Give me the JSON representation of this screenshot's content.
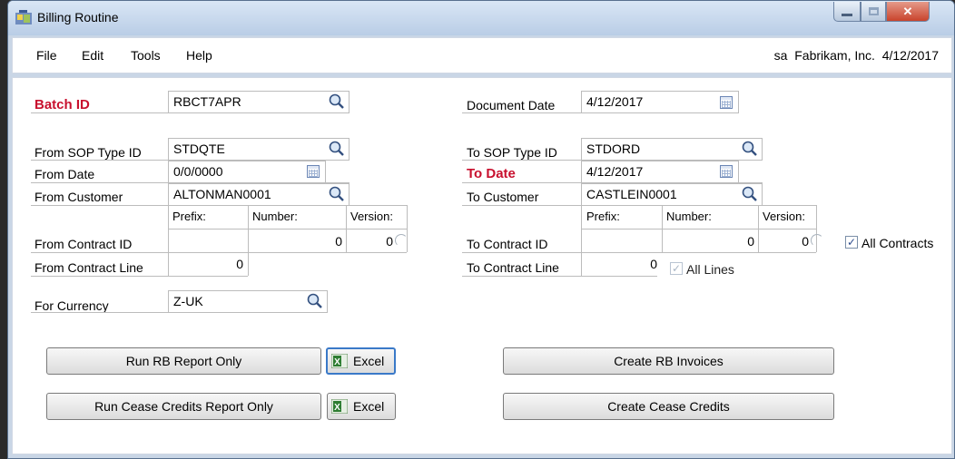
{
  "window": {
    "title": "Billing Routine"
  },
  "menu": {
    "items": [
      "File",
      "Edit",
      "Tools",
      "Help"
    ],
    "user_info": "sa  Fabrikam, Inc.  4/12/2017"
  },
  "form": {
    "batch_id": {
      "label": "Batch ID",
      "value": "RBCT7APR"
    },
    "document_date": {
      "label": "Document Date",
      "value": "4/12/2017"
    },
    "from_sop_type": {
      "label": "From SOP Type ID",
      "value": "STDQTE"
    },
    "to_sop_type": {
      "label": "To SOP Type ID",
      "value": "STDORD"
    },
    "from_date": {
      "label": "From Date",
      "value": "0/0/0000"
    },
    "to_date": {
      "label": "To Date",
      "value": "4/12/2017"
    },
    "from_customer": {
      "label": "From Customer",
      "value": "ALTONMAN0001"
    },
    "to_customer": {
      "label": "To Customer",
      "value": "CASTLEIN0001"
    },
    "contract_headers": {
      "prefix": "Prefix:",
      "number": "Number:",
      "version": "Version:"
    },
    "from_contract_id": {
      "label": "From Contract ID",
      "number": "0",
      "version": "0"
    },
    "to_contract_id": {
      "label": "To Contract ID",
      "number": "0",
      "version": "0"
    },
    "all_contracts": {
      "label": "All Contracts",
      "checked": true
    },
    "from_contract_line": {
      "label": "From Contract Line",
      "value": "0"
    },
    "to_contract_line": {
      "label": "To Contract Line",
      "value": "0"
    },
    "all_lines": {
      "label": "All Lines",
      "checked": true
    },
    "currency": {
      "label": "For Currency",
      "value": "Z-UK"
    }
  },
  "buttons": {
    "run_rb_report": "Run RB Report Only",
    "excel_1": "Excel",
    "run_cease_report": "Run Cease Credits Report Only",
    "excel_2": "Excel",
    "create_rb_invoices": "Create RB Invoices",
    "create_cease_credits": "Create Cease Credits"
  },
  "colors": {
    "required_label": "#c8102e",
    "window_frame": "#c9d6e6",
    "focus": "#3a79c8"
  }
}
